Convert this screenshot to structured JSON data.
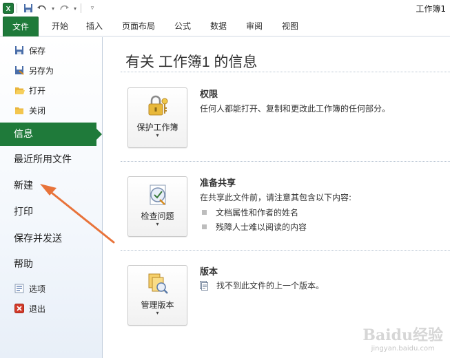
{
  "titlebar": {
    "doc_title": "工作簿1",
    "icons": [
      "excel-app-icon",
      "save-icon",
      "undo-icon",
      "redo-icon",
      "customize-quick-access-icon"
    ]
  },
  "ribbon": {
    "tabs": [
      "文件",
      "开始",
      "插入",
      "页面布局",
      "公式",
      "数据",
      "审阅",
      "视图"
    ]
  },
  "leftnav": {
    "small_top": [
      {
        "label": "保存",
        "icon": "save-icon"
      },
      {
        "label": "另存为",
        "icon": "save-as-icon"
      },
      {
        "label": "打开",
        "icon": "open-folder-icon"
      },
      {
        "label": "关闭",
        "icon": "close-folder-icon"
      }
    ],
    "active": "信息",
    "big": [
      "最近所用文件",
      "新建",
      "打印",
      "保存并发送",
      "帮助"
    ],
    "small_bottom": [
      {
        "label": "选项",
        "icon": "options-icon"
      },
      {
        "label": "退出",
        "icon": "exit-icon"
      }
    ]
  },
  "main": {
    "title": "有关 工作簿1 的信息",
    "sections": [
      {
        "button_label": "保护工作簿",
        "button_icon": "lock-keys-icon",
        "title": "权限",
        "desc": "任何人都能打开、复制和更改此工作簿的任何部分。"
      },
      {
        "button_label": "检查问题",
        "button_icon": "checklist-icon",
        "title": "准备共享",
        "desc": "在共享此文件前，请注意其包含以下内容:",
        "bullets": [
          "文档属性和作者的姓名",
          "残障人士难以阅读的内容"
        ]
      },
      {
        "button_label": "管理版本",
        "button_icon": "versions-icon",
        "title": "版本",
        "bullets": [
          "找不到此文件的上一个版本。"
        ]
      }
    ],
    "dropdown_glyph": "▾"
  },
  "watermark": {
    "logo": "Baidu经验",
    "url": "jingyan.baidu.com"
  },
  "colors": {
    "accent_green": "#1f7a3a",
    "arrow_orange": "#e8733a"
  }
}
